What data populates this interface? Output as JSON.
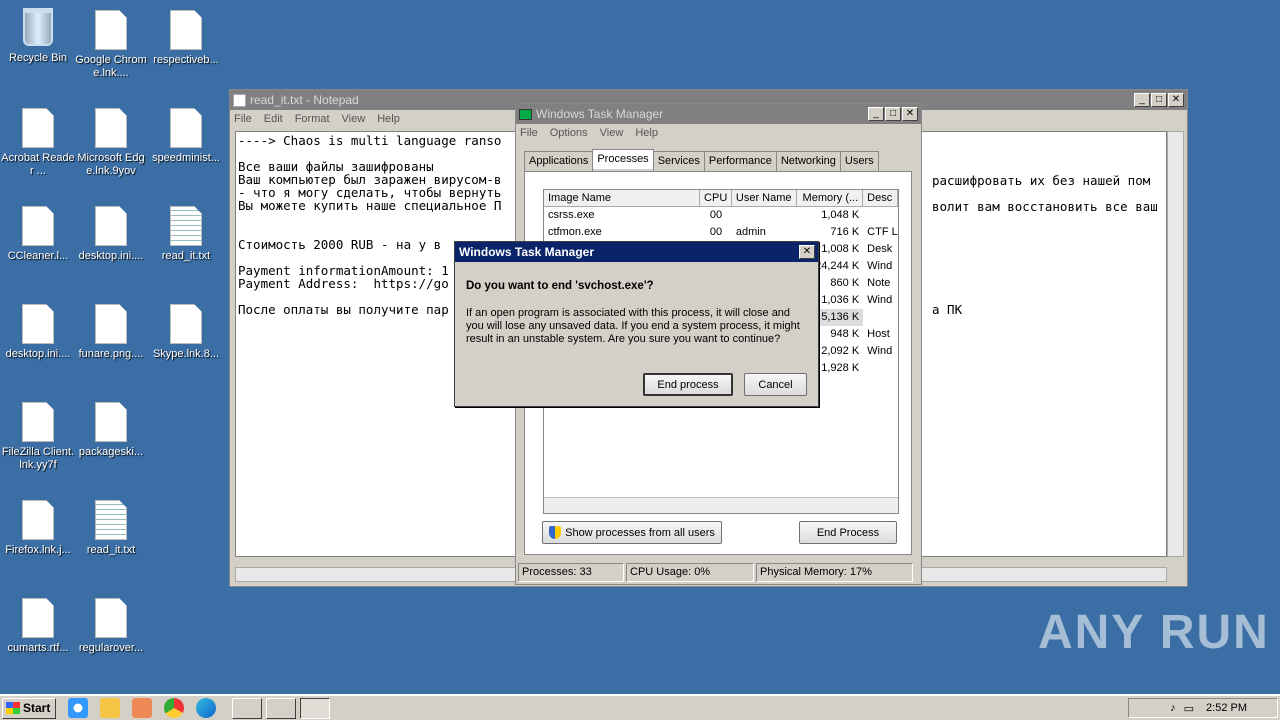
{
  "desktop_icons": [
    {
      "label": "Recycle Bin"
    },
    {
      "label": "Google Chrome.lnk...."
    },
    {
      "label": "respectiveb..."
    },
    {
      "label": "Acrobat Reader ..."
    },
    {
      "label": "Microsoft Edge.lnk.9yov"
    },
    {
      "label": "speedminist..."
    },
    {
      "label": "CCleaner.l..."
    },
    {
      "label": "desktop.ini...."
    },
    {
      "label": "read_it.txt"
    },
    {
      "label": "desktop.ini...."
    },
    {
      "label": "funare.png...."
    },
    {
      "label": "Skype.lnk.8..."
    },
    {
      "label": "FileZilla Client.lnk.yy7f"
    },
    {
      "label": "packageski..."
    },
    {
      "label": "Firefox.lnk.j..."
    },
    {
      "label": "read_it.txt"
    },
    {
      "label": "cumarts.rtf..."
    },
    {
      "label": "regularover..."
    }
  ],
  "notepad": {
    "title": "read_it.txt - Notepad",
    "menu": [
      "File",
      "Edit",
      "Format",
      "View",
      "Help"
    ],
    "lines": [
      "----> Chaos is multi language ranso",
      "",
      "Все ваши файлы зашифрованы",
      "Ваш компьютер был заражен вирусом-в",
      "- что я могу сделать, чтобы вернуть",
      "Вы можете купить наше специальное П",
      "",
      "",
      "Стоимость 2000 RUB - на у в",
      "",
      "Payment informationAmount: 1",
      "Payment Address:  https://go",
      "",
      "После оплаты вы получите пар"
    ],
    "right_fragments": [
      {
        "text": "расшифровать их без нашей пом"
      },
      {
        "text": "волит вам восстановить все ваш"
      },
      {
        "text": "а ПК"
      }
    ]
  },
  "taskmgr": {
    "title": "Windows Task Manager",
    "menu": [
      "File",
      "Options",
      "View",
      "Help"
    ],
    "tabs": [
      "Applications",
      "Processes",
      "Services",
      "Performance",
      "Networking",
      "Users"
    ],
    "selected_tab": "Processes",
    "columns": [
      "Image Name",
      "CPU",
      "User Name",
      "Memory (...",
      "Desc"
    ],
    "rows": [
      {
        "name": "csrss.exe",
        "cpu": "00",
        "user": "",
        "mem": "1,048 K",
        "desc": ""
      },
      {
        "name": "ctfmon.exe",
        "cpu": "00",
        "user": "admin",
        "mem": "716 K",
        "desc": "CTF L"
      },
      {
        "name": "",
        "cpu": "",
        "user": "",
        "mem": "1,008 K",
        "desc": "Desk"
      },
      {
        "name": "",
        "cpu": "",
        "user": "",
        "mem": "24,244 K",
        "desc": "Wind"
      },
      {
        "name": "",
        "cpu": "",
        "user": "",
        "mem": "860 K",
        "desc": "Note"
      },
      {
        "name": "",
        "cpu": "",
        "user": "",
        "mem": "1,036 K",
        "desc": "Wind"
      },
      {
        "name": "",
        "cpu": "",
        "user": "",
        "mem": "5,136 K",
        "desc": ""
      },
      {
        "name": "",
        "cpu": "",
        "user": "",
        "mem": "948 K",
        "desc": "Host"
      },
      {
        "name": "",
        "cpu": "",
        "user": "",
        "mem": "2,092 K",
        "desc": "Wind"
      },
      {
        "name": "",
        "cpu": "",
        "user": "",
        "mem": "1,928 K",
        "desc": ""
      }
    ],
    "show_all_label": "Show processes from all users",
    "end_process_label": "End Process",
    "status": {
      "processes": "Processes: 33",
      "cpu": "CPU Usage: 0%",
      "memory": "Physical Memory: 17%"
    }
  },
  "dialog": {
    "title": "Windows Task Manager",
    "question": "Do you want to end 'svchost.exe'?",
    "message": "If an open program is associated with this process, it will close and you will lose any unsaved data. If you end a system process, it might result in an unstable system. Are you sure you want to continue?",
    "confirm_label": "End process",
    "cancel_label": "Cancel"
  },
  "taskbar": {
    "start_label": "Start",
    "clock": "2:52 PM"
  },
  "watermark": "ANY RUN"
}
